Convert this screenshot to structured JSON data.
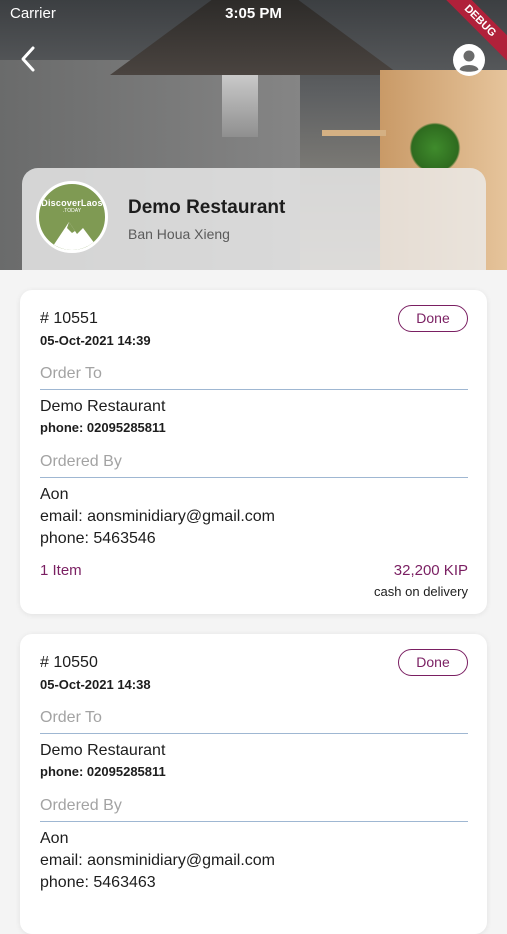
{
  "status_bar": {
    "carrier": "Carrier",
    "time": "3:05 PM"
  },
  "debug_label": "DEBUG",
  "restaurant": {
    "name": "Demo Restaurant",
    "address": "Ban Houa Xieng",
    "logo": {
      "title": "DiscoverLaos",
      "subtitle": ".TODAY"
    }
  },
  "labels": {
    "order_to": "Order To",
    "ordered_by": "Ordered By"
  },
  "colors": {
    "accent": "#7a1f62",
    "divider": "#9fb7d2"
  },
  "orders": [
    {
      "number": "# 10551",
      "date": "05-Oct-2021  14:39",
      "status": "Done",
      "to_name": "Demo Restaurant",
      "to_phone": "phone: 02095285811",
      "by_name": "Aon",
      "by_email": "email: aonsminidiary@gmail.com",
      "by_phone": "phone: 5463546",
      "items": "1 Item",
      "price": "32,200 KIP",
      "payment": "cash on delivery"
    },
    {
      "number": "# 10550",
      "date": "05-Oct-2021  14:38",
      "status": "Done",
      "to_name": "Demo Restaurant",
      "to_phone": "phone: 02095285811",
      "by_name": "Aon",
      "by_email": "email: aonsminidiary@gmail.com",
      "by_phone": "phone: 5463463"
    }
  ]
}
